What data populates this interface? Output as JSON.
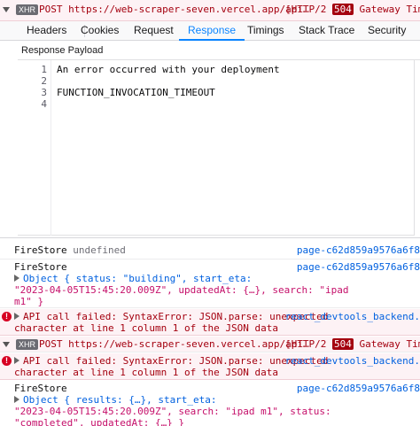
{
  "xhr_header": {
    "tag": "XHR",
    "method_url": "POST https://web-scraper-seven.vercel.app/api…",
    "protocol": "[HTTP/2",
    "status_code": "504",
    "status_text": "Gateway Timeou"
  },
  "tabs": [
    {
      "label": "Headers"
    },
    {
      "label": "Cookies"
    },
    {
      "label": "Request"
    },
    {
      "label": "Response"
    },
    {
      "label": "Timings"
    },
    {
      "label": "Stack Trace"
    },
    {
      "label": "Security"
    }
  ],
  "active_tab": "Response",
  "response_payload": {
    "label": "Response Payload",
    "lines": [
      {
        "num": "1",
        "text": "An error occurred with your deployment"
      },
      {
        "num": "2",
        "text": ""
      },
      {
        "num": "3",
        "text": "FUNCTION_INVOCATION_TIMEOUT"
      },
      {
        "num": "4",
        "text": ""
      }
    ]
  },
  "console": {
    "row1": {
      "prefix": "FireStore",
      "value": "undefined",
      "source": "page-c62d859a9576a6f8"
    },
    "row2": {
      "prefix": "FireStore",
      "line1": "Object { status: \"building\", start_eta:",
      "line2": "\"2023-04-05T15:45:20.009Z\", updatedAt: {…}, search: \"ipad",
      "line3": "m1\" }",
      "source": "page-c62d859a9576a6f8"
    },
    "row3": {
      "line1": "API call failed: SyntaxError: JSON.parse: unexpected",
      "line2": "character at line 1 column 1 of the JSON data",
      "source": "react_devtools_backend."
    },
    "row4": {
      "tag": "XHR",
      "method_url": "POST https://web-scraper-seven.vercel.app/api…",
      "protocol": "[HTTP/2",
      "status_code": "504",
      "status_text": "Gateway Timeou"
    },
    "row5": {
      "line1": "API call failed: SyntaxError: JSON.parse: unexpected",
      "line2": "character at line 1 column 1 of the JSON data",
      "source": "react_devtools_backend."
    },
    "row6": {
      "prefix": "FireStore",
      "line1": "Object { results: {…}, start_eta:",
      "line2": "\"2023-04-05T15:45:20.009Z\", search: \"ipad m1\", status:",
      "line3": "\"completed\", updatedAt: {…} }",
      "source": "page-c62d859a9576a6f8"
    }
  }
}
